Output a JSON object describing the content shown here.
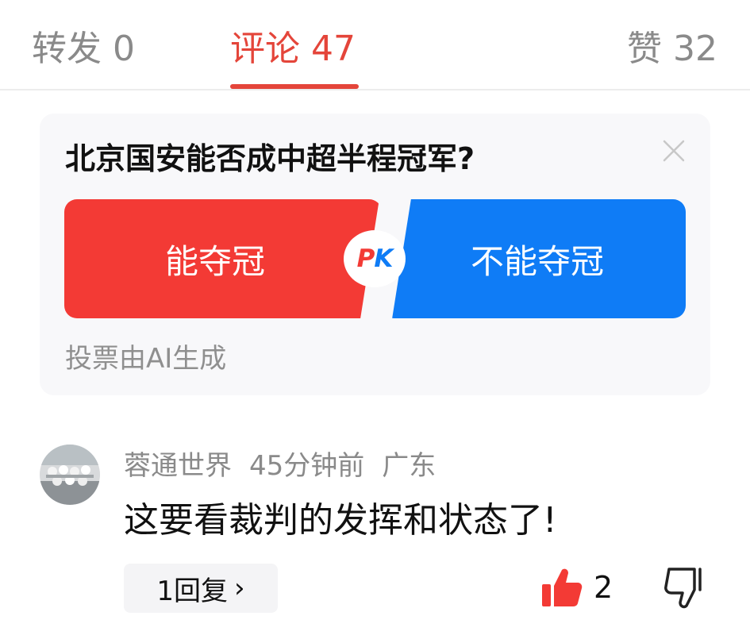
{
  "tabs": [
    {
      "label": "转发 0"
    },
    {
      "label": "评论 47"
    },
    {
      "label": "赞 32"
    }
  ],
  "active_tab": "评论 47",
  "poll": {
    "question": "北京国安能否成中超半程冠军?",
    "option_yes": "能夺冠",
    "option_no": "不能夺冠",
    "pk_left": "P",
    "pk_right": "K",
    "footnote": "投票由AI生成",
    "close_icon": "close-icon"
  },
  "comment": {
    "username": "蓉通世界",
    "time": "45分钟前",
    "location": "广东",
    "text": "这要看裁判的发挥和状态了!",
    "reply_label": "1回复",
    "reply_chevron": "›",
    "like_count": "2",
    "like_icon": "thumbs-up-icon",
    "dislike_icon": "thumbs-down-icon"
  },
  "colors": {
    "accent_red": "#e4453a",
    "option_red": "#f33a35",
    "option_blue": "#0f7cf6",
    "muted_text": "#8a8a8a"
  }
}
